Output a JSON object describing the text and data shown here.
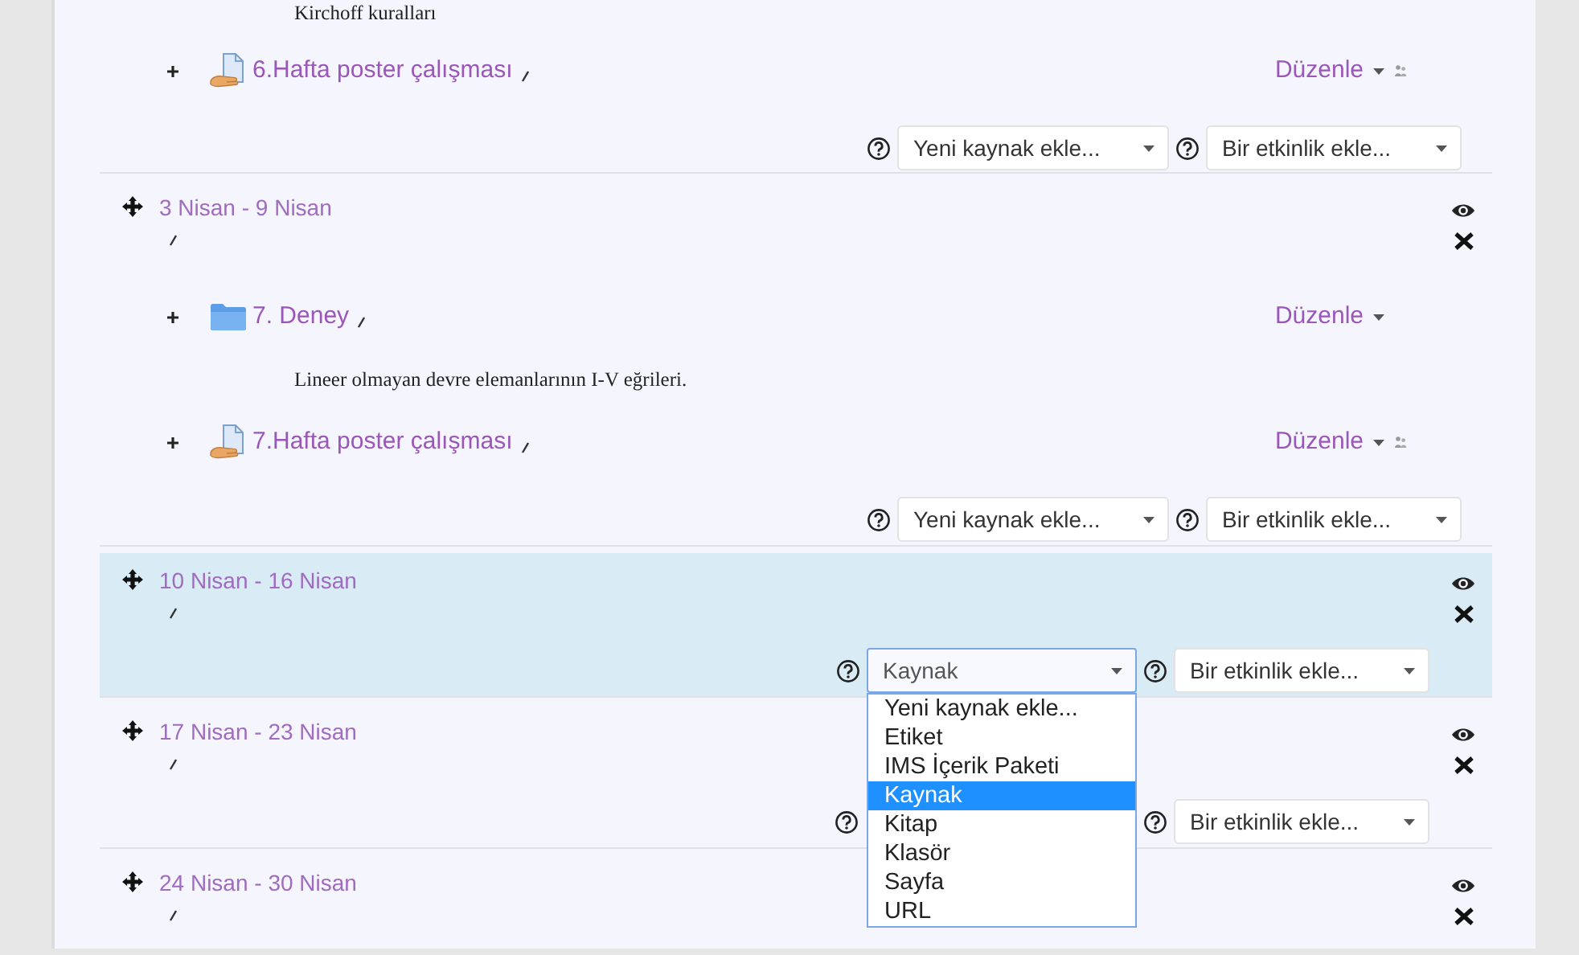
{
  "top_section": {
    "items": [
      {
        "kind": "description",
        "text": "Kirchoff kuralları"
      },
      {
        "kind": "page",
        "title": "6.Hafta poster çalışması",
        "edit_label": "Düzenle",
        "group_icon": true
      }
    ],
    "add_row": {
      "resource_select": {
        "value": "Yeni kaynak ekle...",
        "open": false
      },
      "activity_select": {
        "value": "Bir etkinlik ekle..."
      }
    }
  },
  "sections": [
    {
      "title": "3 Nisan - 9 Nisan",
      "highlighted": false,
      "items": [
        {
          "kind": "folder",
          "title": "7. Deney",
          "edit_label": "Düzenle",
          "group_icon": false
        },
        {
          "kind": "description",
          "text": "Lineer olmayan devre elemanlarının I-V eğrileri."
        },
        {
          "kind": "page",
          "title": "7.Hafta poster çalışması",
          "edit_label": "Düzenle",
          "group_icon": true
        }
      ],
      "add_row": {
        "resource_select": {
          "value": "Yeni kaynak ekle...",
          "open": false
        },
        "activity_select": {
          "value": "Bir etkinlik ekle..."
        }
      }
    },
    {
      "title": "10 Nisan - 16 Nisan",
      "highlighted": true,
      "add_row": {
        "resource_select": {
          "value": "Kaynak",
          "open": true,
          "options": [
            {
              "label": "Yeni kaynak ekle...",
              "selected": false
            },
            {
              "label": "Etiket",
              "selected": false
            },
            {
              "label": "IMS İçerik Paketi",
              "selected": false
            },
            {
              "label": "Kaynak",
              "selected": true
            },
            {
              "label": "Kitap",
              "selected": false
            },
            {
              "label": "Klasör",
              "selected": false
            },
            {
              "label": "Sayfa",
              "selected": false
            },
            {
              "label": "URL",
              "selected": false
            }
          ]
        },
        "activity_select": {
          "value": "Bir etkinlik ekle..."
        }
      }
    },
    {
      "title": "17 Nisan - 23 Nisan",
      "highlighted": false,
      "add_row": {
        "activity_select": {
          "value": "Bir etkinlik ekle..."
        }
      }
    },
    {
      "title": "24 Nisan - 30 Nisan",
      "highlighted": false
    }
  ]
}
